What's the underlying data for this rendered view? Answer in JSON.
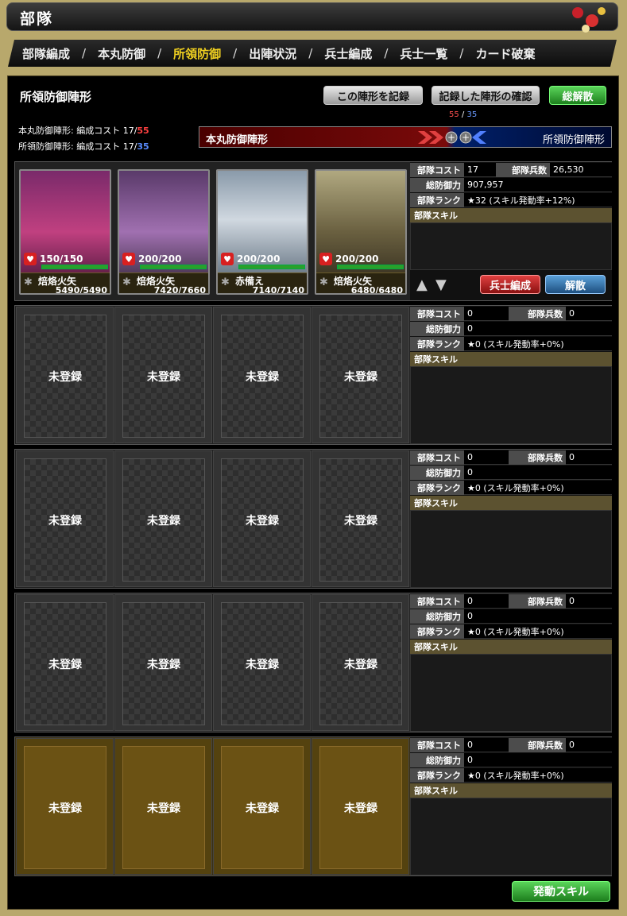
{
  "title": "部隊",
  "tabs": [
    "部隊編成",
    "本丸防御",
    "所領防御",
    "出陣状況",
    "兵士編成",
    "兵士一覧",
    "カード破棄"
  ],
  "active_tab": 2,
  "panel": {
    "title": "所領防御陣形",
    "record_btn": "この陣形を記録",
    "confirm_btn": "記録した陣形の確認",
    "disband_all_btn": "総解散",
    "honmaru_cost_label": "本丸防御陣形: 編成コスト 17/",
    "honmaru_cost_max": "55",
    "shoryo_cost_label": "所領防御陣形: 編成コスト 17/",
    "shoryo_cost_max": "35",
    "bar_num_red": "55",
    "bar_num_sep": " / ",
    "bar_num_blue": "35",
    "bar_left": "本丸防御陣形",
    "bar_right": "所領防御陣形",
    "skill_button": "発動スキル"
  },
  "labels": {
    "cost": "部隊コスト",
    "soldiers": "部隊兵数",
    "defense": "総防御力",
    "rank": "部隊ランク",
    "skill": "部隊スキル",
    "unregistered": "未登録",
    "soldier_edit": "兵士編成",
    "disband": "解散"
  },
  "unit1": {
    "cost": "17",
    "soldiers": "26,530",
    "defense": "907,957",
    "rank": "★32 (スキル発動率+12%)",
    "cards": [
      {
        "hp": "150/150",
        "skill": "焙烙火矢",
        "cur": "5490",
        "max": "/5490"
      },
      {
        "hp": "200/200",
        "skill": "焙烙火矢",
        "cur": "7420",
        "max": "/7660"
      },
      {
        "hp": "200/200",
        "skill": "赤備え",
        "cur": "7140",
        "max": "/7140"
      },
      {
        "hp": "200/200",
        "skill": "焙烙火矢",
        "cur": "6480",
        "max": "/6480"
      }
    ]
  },
  "empty_unit": {
    "cost": "0",
    "soldiers": "0",
    "defense": "0",
    "rank": "★0 (スキル発動率+0%)"
  }
}
